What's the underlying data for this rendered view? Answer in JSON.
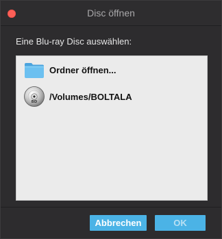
{
  "window": {
    "title": "Disc öffnen"
  },
  "prompt": "Eine Blu-ray Disc auswählen:",
  "list": {
    "items": [
      {
        "label": "Ordner öffnen...",
        "icon": "folder-icon"
      },
      {
        "label": "/Volumes/BOLTALA",
        "icon": "bluray-disc-icon"
      }
    ]
  },
  "buttons": {
    "cancel_label": "Abbrechen",
    "ok_label": "OK"
  },
  "colors": {
    "accent": "#4bb3e6",
    "close": "#fd5f57",
    "background": "#2d2c2e",
    "list_background": "#ebebeb"
  }
}
